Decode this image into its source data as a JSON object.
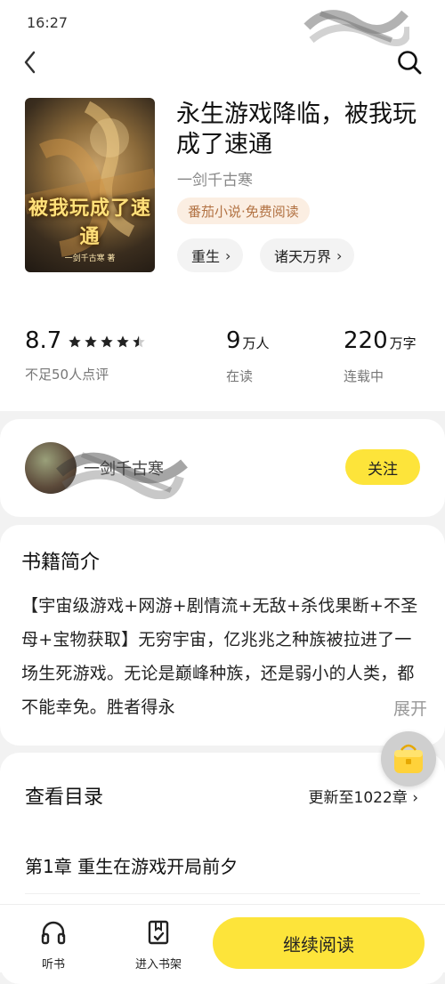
{
  "status": {
    "time": "16:27"
  },
  "book": {
    "title": "永生游戏降临，被我玩成了速通",
    "author": "一剑千古寒",
    "source": "番茄小说·免费阅读",
    "tags": [
      "重生",
      "诸天万界"
    ],
    "cover_title": "被我玩成了速通",
    "cover_sub": "一剑千古寒 著"
  },
  "stats": {
    "rating": "8.7",
    "rating_stars": 4.5,
    "rating_note": "不足50人点评",
    "readers_num": "9",
    "readers_unit": "万人",
    "readers_label": "在读",
    "words_num": "220",
    "words_unit": "万字",
    "words_label": "连载中"
  },
  "author_card": {
    "name": "一剑千古寒",
    "follow_label": "关注"
  },
  "intro": {
    "heading": "书籍简介",
    "text": "【宇宙级游戏+网游+剧情流+无敌+杀伐果断+不圣母+宝物获取】无穷宇宙，亿兆兆之种族被拉进了一场生死游戏。无论是巅峰种族，还是弱小的人类，都不能幸免。胜者得永",
    "expand_label": "展开"
  },
  "toc": {
    "heading": "查看目录",
    "update": "更新至1022章",
    "first_chapter": "第1章 重生在游戏开局前夕"
  },
  "bottom": {
    "listen_label": "听书",
    "shelf_label": "进入书架",
    "continue_label": "继续阅读"
  },
  "colors": {
    "accent": "#fde43a",
    "tag_bg": "#fbeee2",
    "tag_text": "#b27243"
  }
}
